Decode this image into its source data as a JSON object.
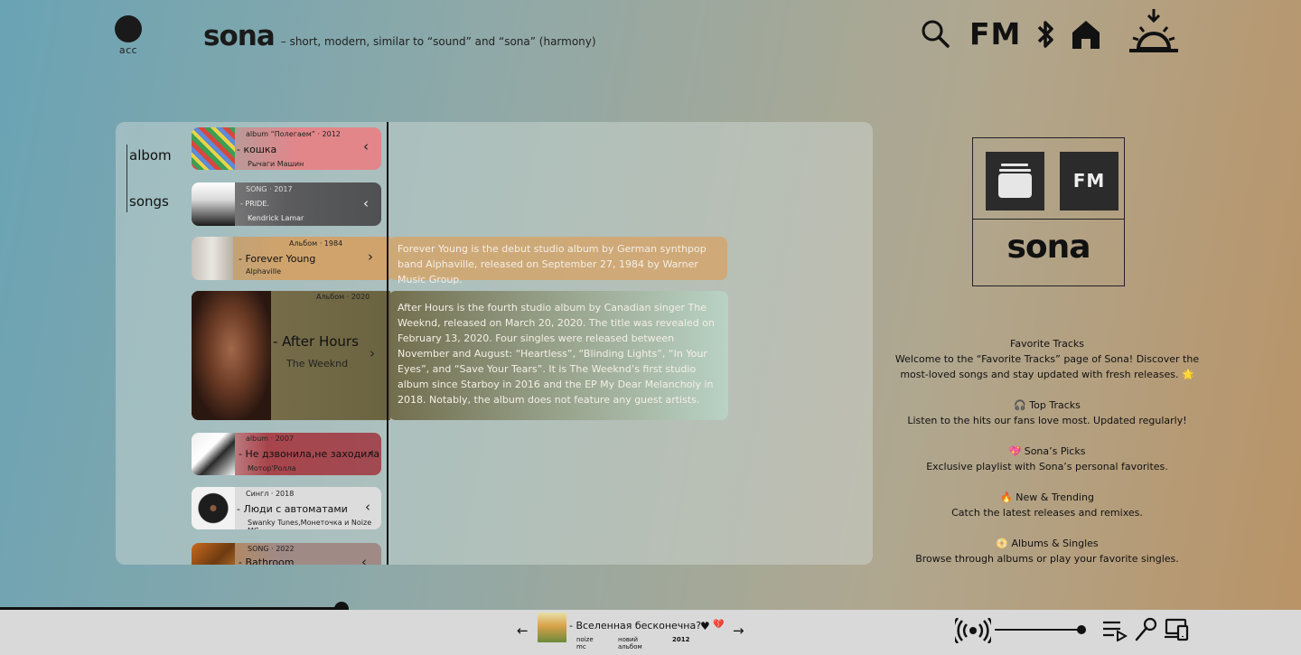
{
  "header": {
    "acc_label": "acc",
    "brand": "sona",
    "tagline": "– short, modern, similar to “sound” and “sona” (harmony)",
    "fm_label": "FM"
  },
  "tabs": [
    {
      "label": "albom"
    },
    {
      "label": "songs"
    }
  ],
  "cards": [
    {
      "meta": "album “Полегаем” · 2012",
      "title": "- кошка",
      "artist": "Рычаги Машин",
      "chevron": "‹",
      "color": "#e2868a"
    },
    {
      "meta": "SONG · 2017",
      "title": "- PRIDE.",
      "artist": "Kendrick Lamar",
      "chevron": "‹",
      "color": "#5c5c5e"
    },
    {
      "meta": "Альбом · 1984",
      "title": "- Forever Young",
      "artist": "Alphaville",
      "chevron": "›",
      "color": "#d0a36c"
    },
    {
      "meta": "Альбом · 2020",
      "title": "- After Hours",
      "artist": "The Weeknd",
      "chevron": "›",
      "color": "#6b6440"
    },
    {
      "meta": "album · 2007",
      "title": "- Не дзвонила,не заходила",
      "artist": "Мотор'Ролла",
      "chevron": "‹",
      "color": "#a8454c"
    },
    {
      "meta": "Сингл · 2018",
      "title": "- Люди с автоматами",
      "artist": "Swanky Tunes,Монеточка и Noize MC",
      "chevron": "‹",
      "color": "#dcdcdc"
    },
    {
      "meta": "SONG · 2022",
      "title": "- Bathroom",
      "artist": "",
      "chevron": "‹",
      "color": "#a08a86"
    }
  ],
  "descriptions": {
    "forever_young": "Forever Young is the debut studio album by German synthpop band Alphaville, released on September 27, 1984 by Warner Music Group.",
    "after_hours": "After Hours is the fourth studio album by Canadian singer The Weeknd, released on March 20, 2020. The title was revealed on February 13, 2020. Four singles were released between November and August: “Heartless”, “Blinding Lights”, “In Your Eyes”, and “Save Your Tears”. It is The Weeknd’s first studio album since Starboy in 2016 and the EP My Dear Melancholy in 2018. Notably, the album does not feature any guest artists."
  },
  "logobox": {
    "tile_fm": "FM",
    "brand": "sona"
  },
  "info": [
    {
      "title": "Favorite Tracks",
      "text": "Welcome to the “Favorite Tracks” page of Sona! Discover the most-loved songs and stay updated with fresh releases. 🌟"
    },
    {
      "title": "🎧 Top Tracks",
      "text": "Listen to the hits our fans love most. Updated regularly!"
    },
    {
      "title": "💖 Sona’s Picks",
      "text": "Exclusive playlist with Sona’s personal favorites."
    },
    {
      "title": "🔥 New & Trending",
      "text": "Catch the latest releases and remixes."
    },
    {
      "title": "📀 Albums & Singles",
      "text": "Browse through albums or play your favorite singles."
    }
  ],
  "player": {
    "prev": "←",
    "next": "→",
    "title": "- Вселенная бесконечна?",
    "artist": "noize mc",
    "type": "новий альбом",
    "year": "2012",
    "like": "♥",
    "dislike": "💔",
    "progress": 0.26,
    "volume": 0.95
  },
  "colors": {
    "bar": "#d9d9d9",
    "dark": "#111111"
  }
}
